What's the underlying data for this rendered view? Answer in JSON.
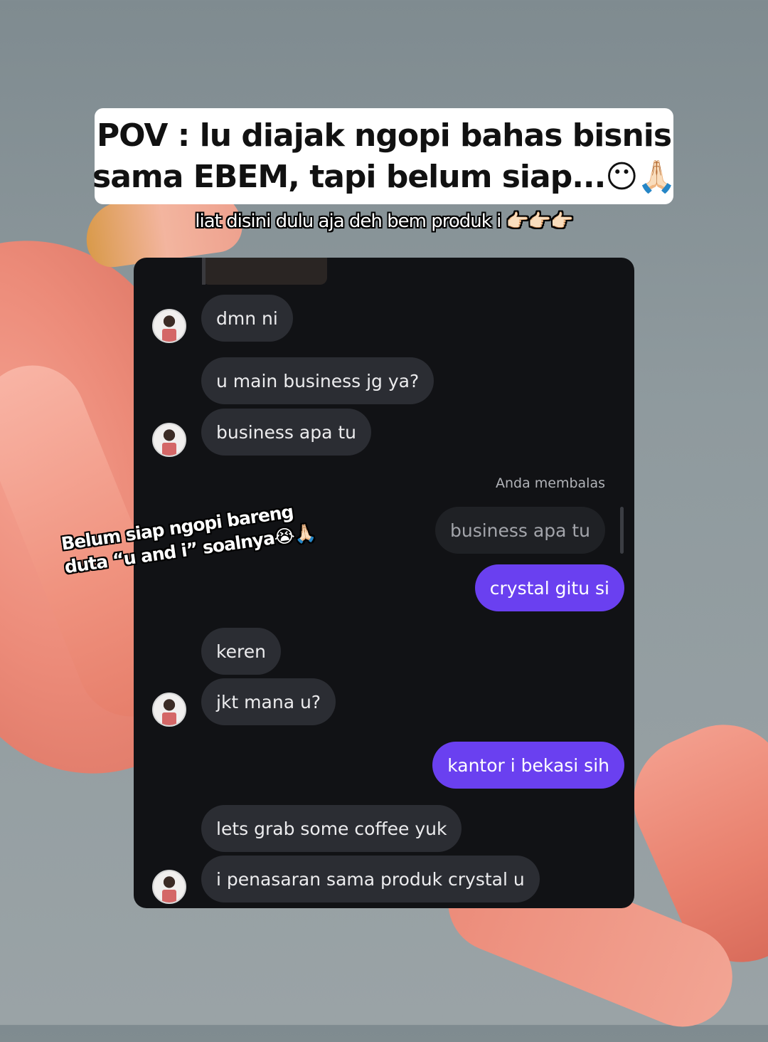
{
  "title": {
    "line1": "POV : lu diajak ngopi bahas bisnis",
    "line2": "sama EBEM, tapi belum siap...😶🙏🏻"
  },
  "subtitle": "liat disini dulu aja deh bem produk i 👉🏻👉🏻👉🏻",
  "overlay_caption": {
    "line1": "Belum siap ngopi bareng",
    "line2": "duta “u and i” soalnya😭🙏🏻"
  },
  "chat": {
    "reply_label": "Anda membalas",
    "messages": [
      {
        "from": "them",
        "text": "dmn ni"
      },
      {
        "from": "them",
        "text": "u main business jg ya?"
      },
      {
        "from": "them",
        "text": "business apa tu"
      },
      {
        "from": "me",
        "quoted": true,
        "text": "business apa tu"
      },
      {
        "from": "me",
        "text": "crystal gitu si"
      },
      {
        "from": "them",
        "text": "keren"
      },
      {
        "from": "them",
        "text": "jkt mana u?"
      },
      {
        "from": "me",
        "text": "kantor i bekasi sih"
      },
      {
        "from": "them",
        "text": "lets grab some coffee yuk"
      },
      {
        "from": "them",
        "text": "i penasaran sama produk crystal u"
      }
    ]
  },
  "colors": {
    "chat_background": "#111215",
    "incoming_bubble": "#2b2d33",
    "outgoing_bubble": "#6a40f0",
    "quoted_bubble": "#1f2125"
  }
}
